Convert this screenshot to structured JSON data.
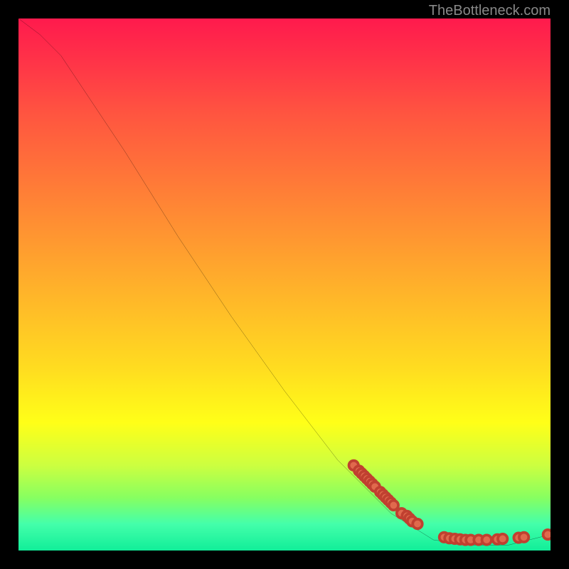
{
  "watermark": "TheBottleneck.com",
  "chart_data": {
    "type": "line",
    "title": "",
    "xlabel": "",
    "ylabel": "",
    "xlim": [
      0,
      100
    ],
    "ylim": [
      0,
      100
    ],
    "curve": [
      {
        "x": 0,
        "y": 100
      },
      {
        "x": 4,
        "y": 97
      },
      {
        "x": 8,
        "y": 93
      },
      {
        "x": 12,
        "y": 87
      },
      {
        "x": 16,
        "y": 81
      },
      {
        "x": 20,
        "y": 75
      },
      {
        "x": 30,
        "y": 59
      },
      {
        "x": 40,
        "y": 44
      },
      {
        "x": 50,
        "y": 30
      },
      {
        "x": 60,
        "y": 17
      },
      {
        "x": 70,
        "y": 7
      },
      {
        "x": 78,
        "y": 2
      },
      {
        "x": 85,
        "y": 1
      },
      {
        "x": 92,
        "y": 1
      },
      {
        "x": 100,
        "y": 3
      }
    ],
    "dots_segment1": [
      {
        "x": 63,
        "y": 16
      },
      {
        "x": 64,
        "y": 15
      },
      {
        "x": 64.5,
        "y": 14.5
      },
      {
        "x": 65,
        "y": 14
      },
      {
        "x": 65.5,
        "y": 13.5
      },
      {
        "x": 66,
        "y": 13
      },
      {
        "x": 66.5,
        "y": 12.5
      },
      {
        "x": 67,
        "y": 12
      },
      {
        "x": 68,
        "y": 11
      },
      {
        "x": 68.5,
        "y": 10.5
      },
      {
        "x": 69,
        "y": 10
      },
      {
        "x": 69.5,
        "y": 9.5
      },
      {
        "x": 70,
        "y": 9
      },
      {
        "x": 70.5,
        "y": 8.5
      },
      {
        "x": 72,
        "y": 7
      },
      {
        "x": 73,
        "y": 6.5
      },
      {
        "x": 73.5,
        "y": 6
      },
      {
        "x": 74,
        "y": 5.5
      },
      {
        "x": 75,
        "y": 5
      }
    ],
    "dots_segment2": [
      {
        "x": 80,
        "y": 2.5
      },
      {
        "x": 81,
        "y": 2.3
      },
      {
        "x": 82,
        "y": 2.2
      },
      {
        "x": 83,
        "y": 2.1
      },
      {
        "x": 84,
        "y": 2
      },
      {
        "x": 85,
        "y": 2
      },
      {
        "x": 86.5,
        "y": 2
      },
      {
        "x": 88,
        "y": 2
      },
      {
        "x": 90,
        "y": 2.1
      },
      {
        "x": 91,
        "y": 2.2
      },
      {
        "x": 94,
        "y": 2.4
      },
      {
        "x": 95,
        "y": 2.5
      },
      {
        "x": 99.5,
        "y": 3
      }
    ]
  }
}
